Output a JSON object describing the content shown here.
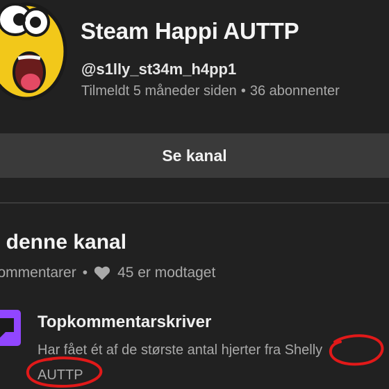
{
  "channel": {
    "name": "Steam Happi AUTTP",
    "handle": "@s1lly_st34m_h4pp1",
    "joined": "Tilmeldt 5 måneder siden",
    "separator": "•",
    "subscribers": "36 abonnenter"
  },
  "view_channel_label": "Se kanal",
  "section": {
    "title": "i denne kanal",
    "comments_text": "kommentarer",
    "separator": "•",
    "hearts_text": "45 er modtaget"
  },
  "badge": {
    "title": "Topkommentarskriver",
    "description_line1": "Har fået ét af de største antal hjerter fra Shelly",
    "description_line2": "AUTTP"
  },
  "colors": {
    "background": "#212121",
    "button": "#3a3a3a",
    "badge_purple": "#9146ff",
    "annotation_red": "#e11919"
  },
  "icons": {
    "avatar": "yellow-laughing-face",
    "heart": "heart-icon",
    "badge": "chat-bubble-badge-icon"
  }
}
